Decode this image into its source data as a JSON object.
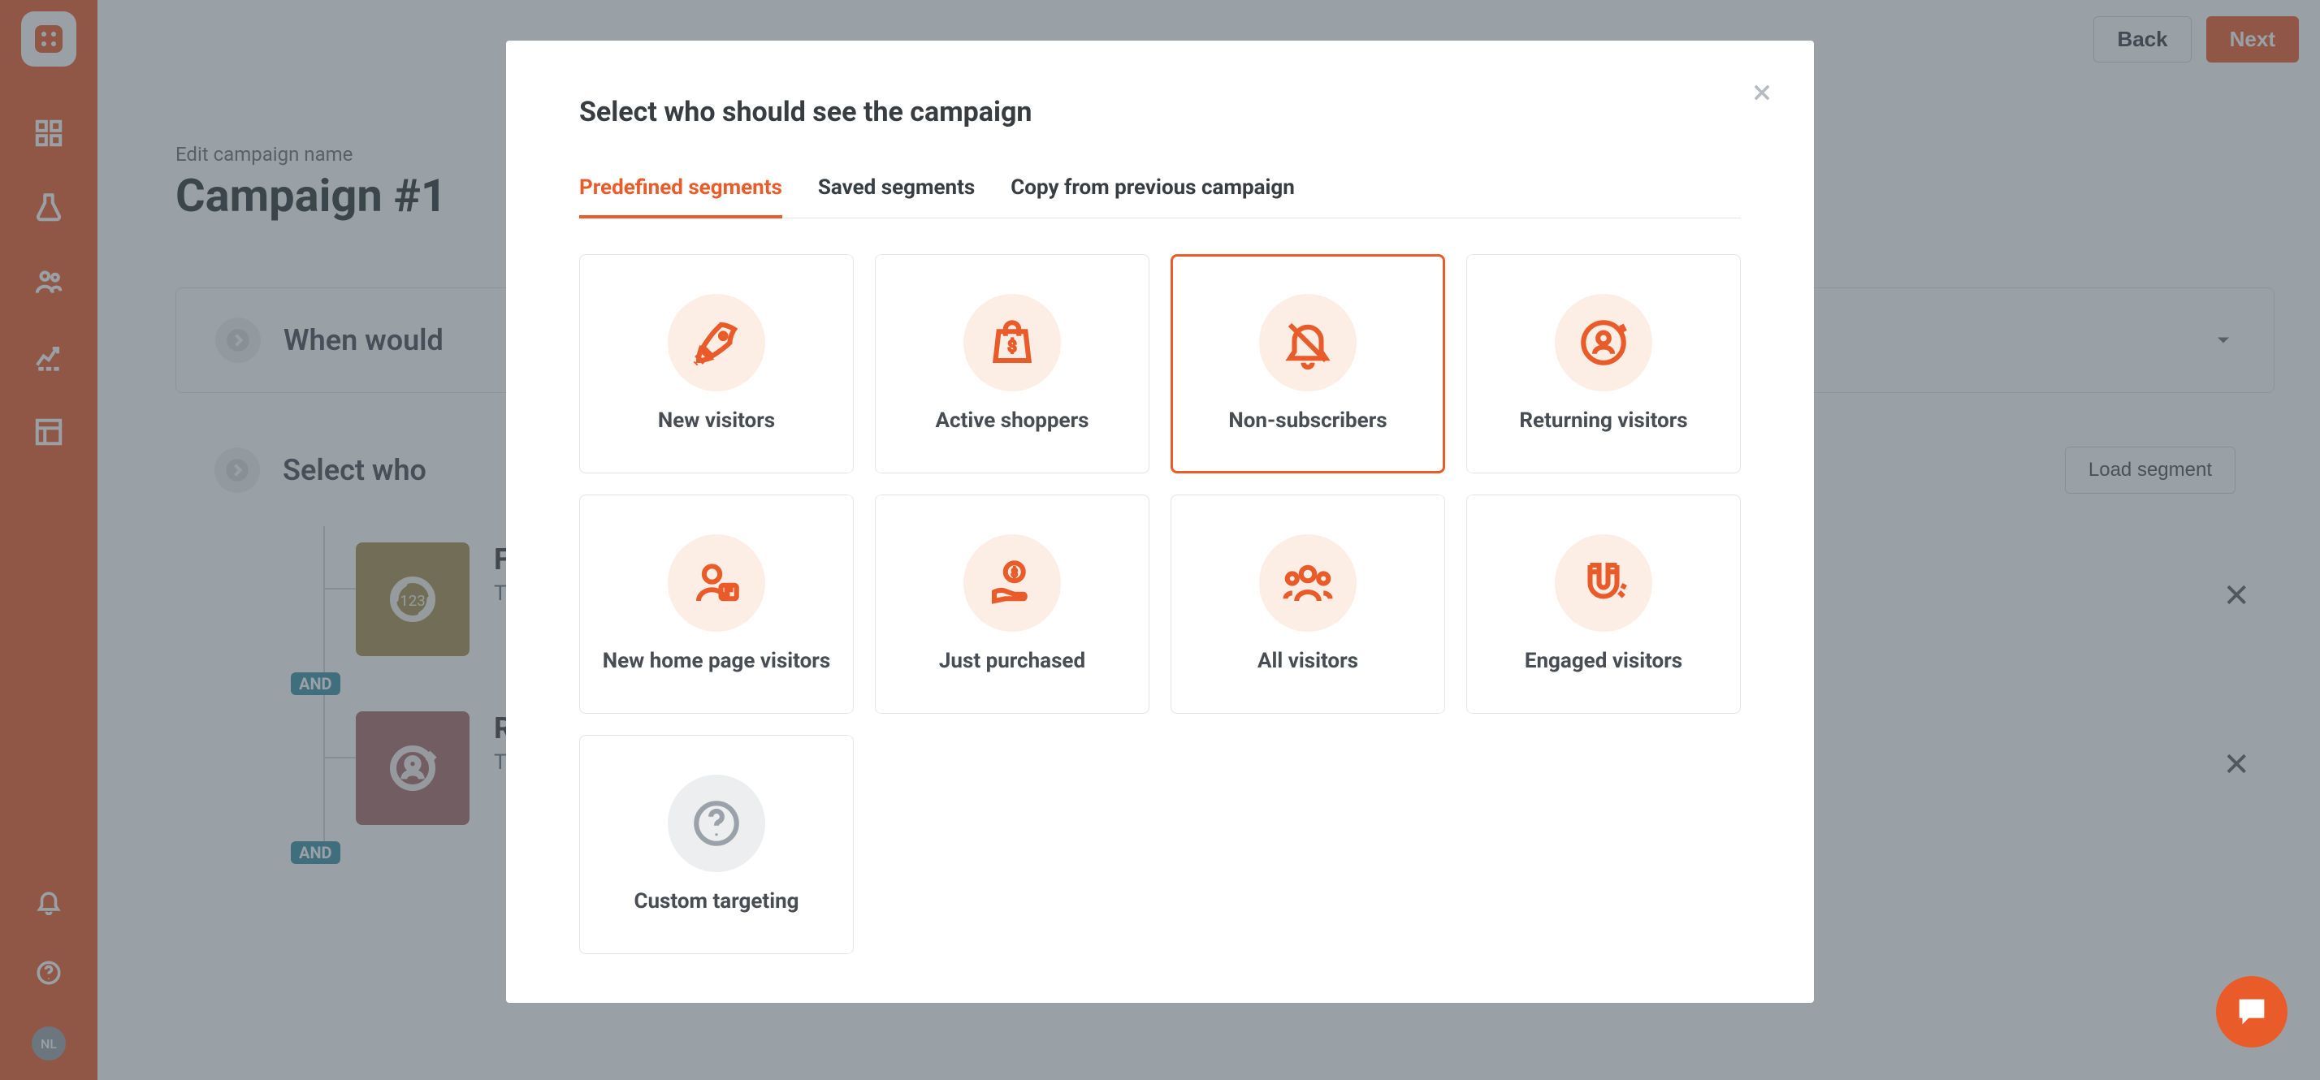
{
  "colors": {
    "accent": "#ea5b2a"
  },
  "header": {
    "back": "Back",
    "next": "Next"
  },
  "page": {
    "edit_link": "Edit campaign name",
    "title": "Campaign #1"
  },
  "section_when": {
    "title": "When would"
  },
  "section_who": {
    "title": "Select who",
    "load_button": "Load segment"
  },
  "rows": [
    {
      "title": "Free",
      "subtitle": "The p",
      "and": "AND"
    },
    {
      "title": "Ret",
      "subtitle": "The p",
      "and": "AND"
    }
  ],
  "avatar": "NL",
  "modal": {
    "title": "Select who should see the campaign",
    "tabs": [
      "Predefined segments",
      "Saved segments",
      "Copy from previous campaign"
    ],
    "active_tab": 0,
    "cards": [
      {
        "id": "new-visitors",
        "label": "New visitors"
      },
      {
        "id": "active-shoppers",
        "label": "Active shoppers"
      },
      {
        "id": "non-subscribers",
        "label": "Non-subscribers",
        "selected": true
      },
      {
        "id": "returning-visitors",
        "label": "Returning visitors"
      },
      {
        "id": "new-home-page-visitors",
        "label": "New home page visitors"
      },
      {
        "id": "just-purchased",
        "label": "Just purchased"
      },
      {
        "id": "all-visitors",
        "label": "All visitors"
      },
      {
        "id": "engaged-visitors",
        "label": "Engaged visitors"
      },
      {
        "id": "custom-targeting",
        "label": "Custom targeting",
        "custom": true
      }
    ]
  }
}
